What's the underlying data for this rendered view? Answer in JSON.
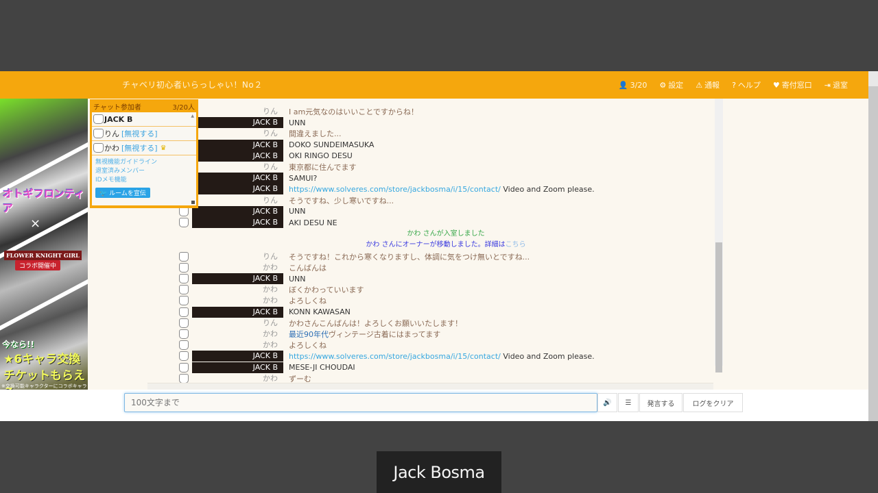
{
  "header": {
    "room_title": "チャベリ初心者いらっしゃい！No２",
    "nav": [
      {
        "icon": "user-icon",
        "glyph": "👤",
        "label": "3/20"
      },
      {
        "icon": "gear-icon",
        "glyph": "⚙",
        "label": "設定"
      },
      {
        "icon": "warning-icon",
        "glyph": "⚠",
        "label": "通報"
      },
      {
        "icon": "help-icon",
        "glyph": "?",
        "label": "ヘルプ"
      },
      {
        "icon": "heart-icon",
        "glyph": "♥",
        "label": "寄付窓口"
      },
      {
        "icon": "exit-icon",
        "glyph": "⇥",
        "label": "退室"
      }
    ],
    "accent_color": "#f5a70d"
  },
  "ad": {
    "logo_text": "オトギフロンティア",
    "x_mark": "×",
    "logo2_text": "FLOWER KNIGHT GIRL",
    "collab_label": "コラボ開催中",
    "now_text": "今なら!!",
    "ticket_line1": "★6キャラ交換",
    "ticket_line2": "チケットもらえる",
    "note": "※交換可能キャラクターにコラボキャラクターは含まれません。"
  },
  "members": {
    "title": "チャット参加者",
    "count": "3/20人",
    "list": [
      {
        "name": "JACK B",
        "ignore": "",
        "owner": false
      },
      {
        "name": "りん",
        "ignore": "[無視する]",
        "owner": false
      },
      {
        "name": "かわ",
        "ignore": "[無視する]",
        "owner": true
      }
    ],
    "crown_glyph": "♛",
    "links": [
      "無視機能ガイドライン",
      "退室済みメンバー",
      "IDメモ機能"
    ],
    "tweet_label": "ルームを宣伝"
  },
  "chat": {
    "messages": [
      {
        "type": "other",
        "name": "りん",
        "text": "I am元気なのはいいことですからね！"
      },
      {
        "type": "jack",
        "name": "JACK B",
        "text": "UNN"
      },
      {
        "type": "other",
        "name": "りん",
        "text": "間違えました..."
      },
      {
        "type": "jack",
        "name": "JACK B",
        "text": "DOKO SUNDEIMASUKA"
      },
      {
        "type": "jack",
        "name": "JACK B",
        "text": "OKI RINGO DESU"
      },
      {
        "type": "other",
        "name": "りん",
        "text": "東京都に住んでます"
      },
      {
        "type": "jack",
        "name": "JACK B",
        "text": "SAMUI?"
      },
      {
        "type": "jack",
        "name": "JACK B",
        "link": "https://www.solveres.com/store/jackbosma/i/15/contact/",
        "text": " Video and Zoom please."
      },
      {
        "type": "other",
        "name": "りん",
        "text": "そうですね、少し寒いですね..."
      },
      {
        "type": "jack",
        "name": "JACK B",
        "text": "UNN"
      },
      {
        "type": "jack",
        "name": "JACK B",
        "text": "AKI DESU NE"
      }
    ],
    "system": [
      {
        "color": "green",
        "text": "かわ さんが入室しました"
      },
      {
        "color": "blue",
        "text": "かわ さんにオーナーが移動しました。詳細は",
        "link": "こちら"
      }
    ],
    "messages2": [
      {
        "type": "other",
        "name": "りん",
        "text": "そうですね！これから寒くなりますし、体調に気をつけ無いとですね..."
      },
      {
        "type": "other",
        "name": "かわ",
        "text": "こんばんは"
      },
      {
        "type": "jack",
        "name": "JACK B",
        "text": "UNN"
      },
      {
        "type": "other",
        "name": "かわ",
        "text": "ぼくかわっていいます"
      },
      {
        "type": "other",
        "name": "かわ",
        "text": "よろしくね"
      },
      {
        "type": "jack",
        "name": "JACK B",
        "text": "KONN KAWASAN"
      },
      {
        "type": "other",
        "name": "りん",
        "text": "かわさんこんばんは！よろしくお願いいたします！"
      },
      {
        "type": "other",
        "name": "かわ",
        "hl": "最近90年代",
        "text": "ヴィンテージ古着にはまってます"
      },
      {
        "type": "other",
        "name": "かわ",
        "text": "よろしくね"
      },
      {
        "type": "jack",
        "name": "JACK B",
        "link": "https://www.solveres.com/store/jackbosma/i/15/contact/",
        "text": " Video and Zoom please."
      },
      {
        "type": "jack",
        "name": "JACK B",
        "text": "MESE-JI CHOUDAI"
      },
      {
        "type": "other",
        "name": "かわ",
        "text": "ずーむ"
      }
    ]
  },
  "input": {
    "placeholder": "100文字まで",
    "value": "",
    "sound_glyph": "🔊",
    "list_glyph": "☰",
    "speak_label": "発言する",
    "clear_label": "ログをクリア"
  },
  "caption": {
    "text": "Jack Bosma"
  }
}
